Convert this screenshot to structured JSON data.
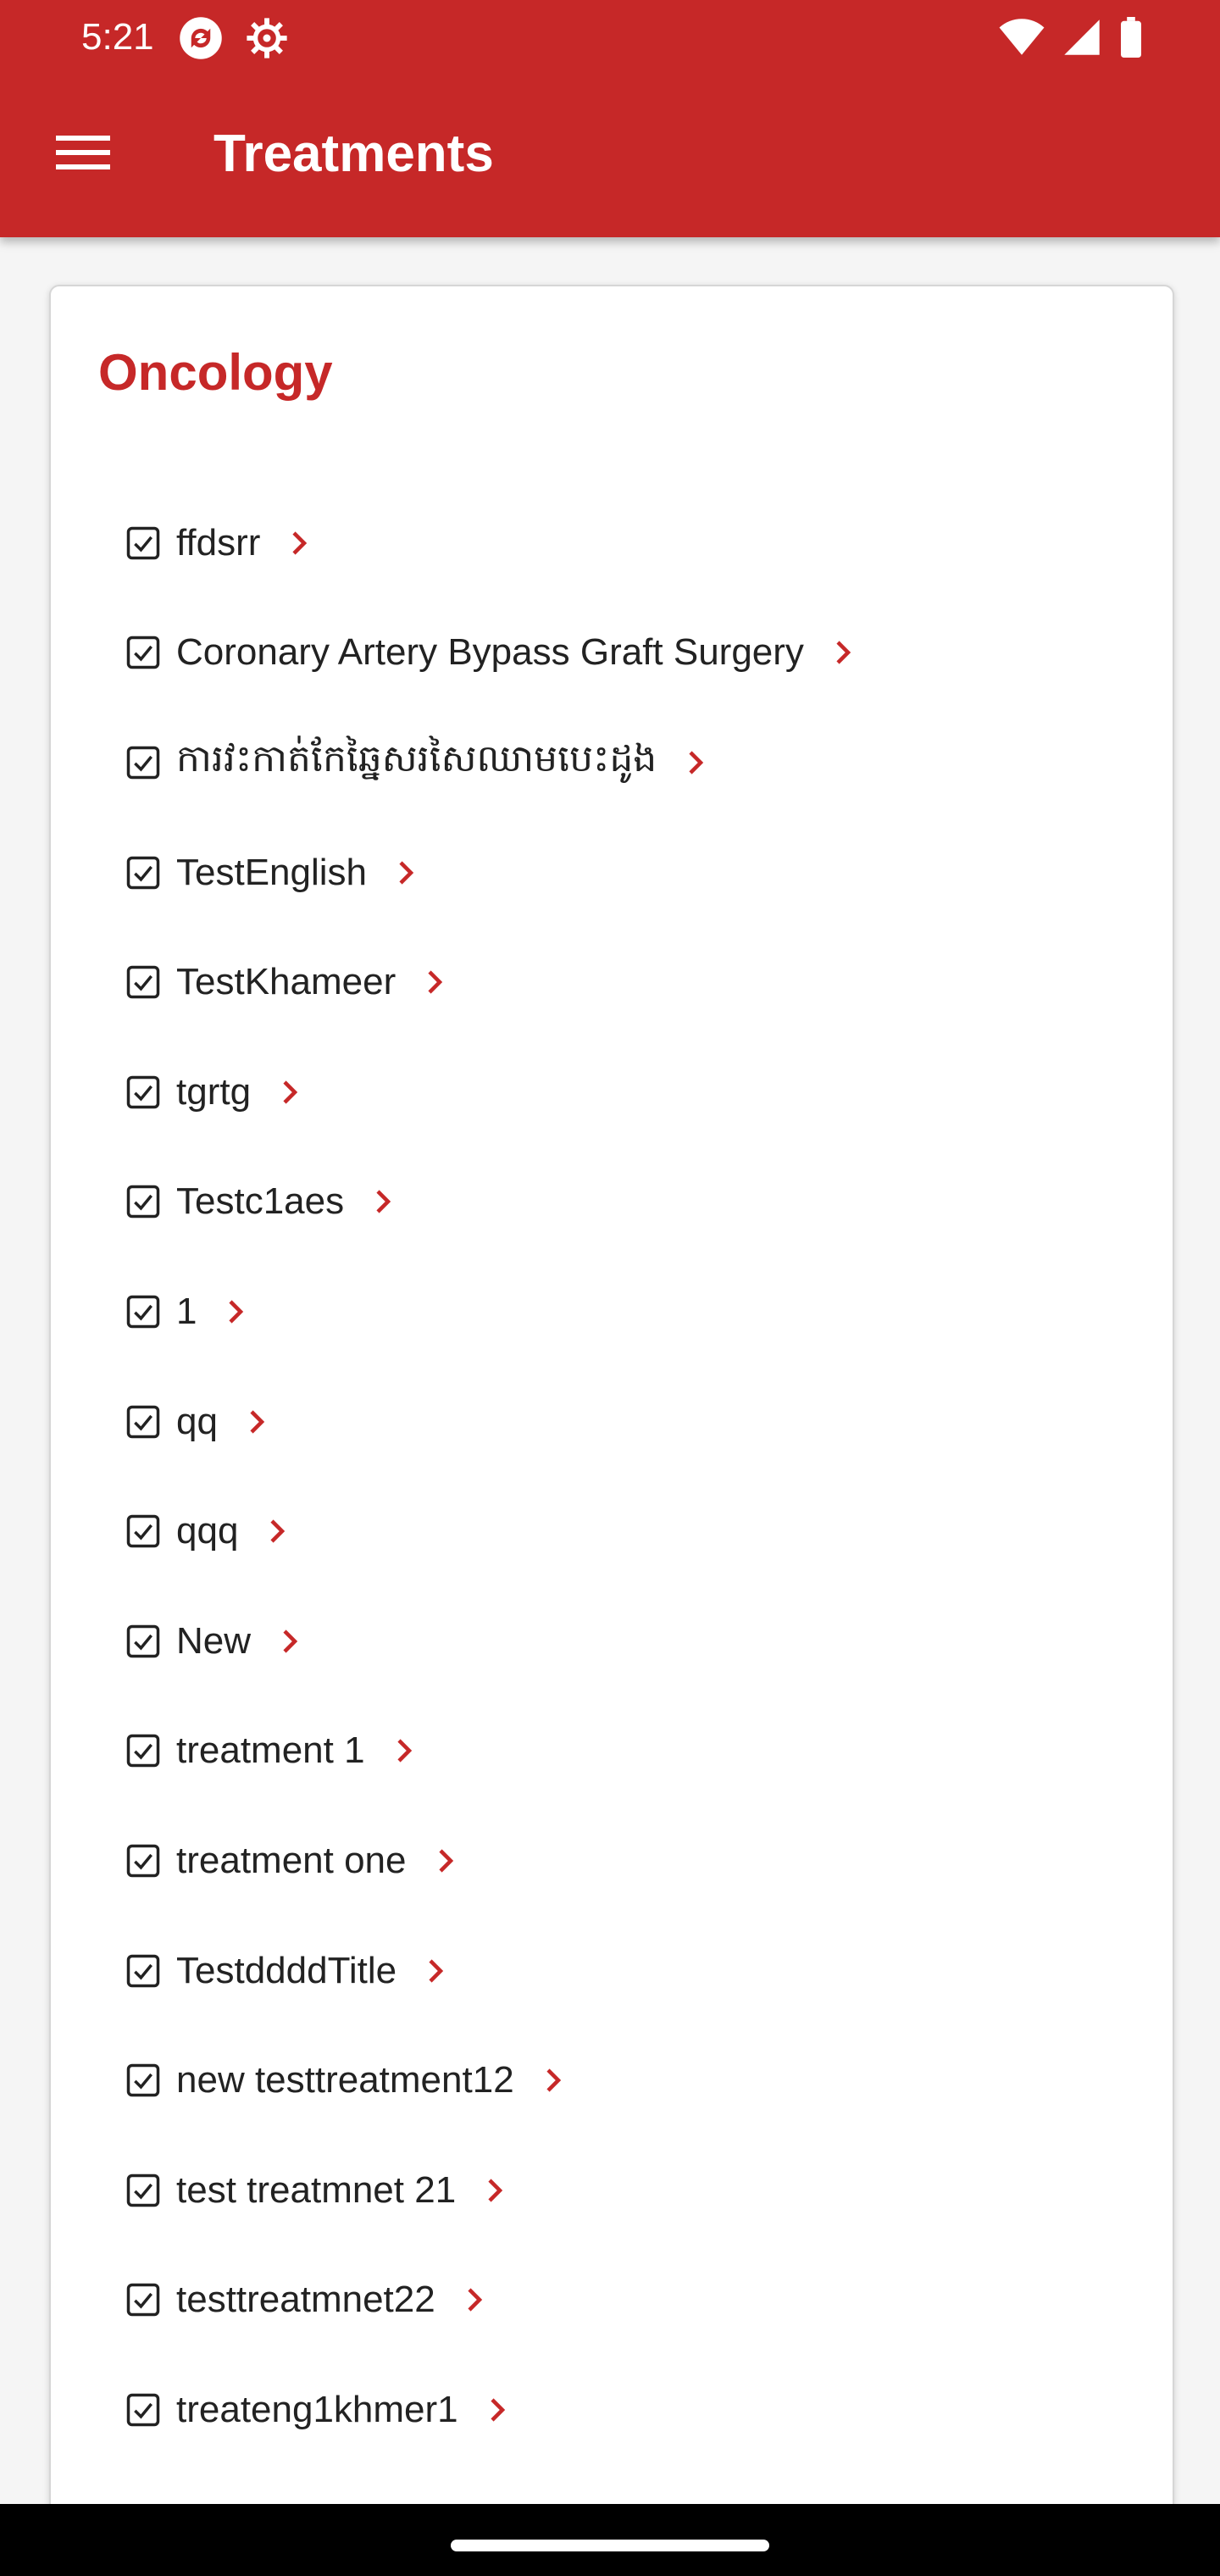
{
  "status_bar": {
    "time": "5:21"
  },
  "app_bar": {
    "title": "Treatments",
    "menu_icon": "hamburger-menu-icon"
  },
  "section": {
    "title": "Oncology"
  },
  "treatments": [
    "ffdsrr",
    "Coronary Artery Bypass Graft Surgery",
    "ការវះកាត់កែឆ្នៃសរសៃឈាមបេះដូង",
    "TestEnglish",
    "TestKhameer",
    "tgrtg",
    "Testc1aes",
    "1",
    "qq",
    "qqq",
    "New",
    "treatment 1",
    "treatment one",
    "TestddddTitle",
    "new testtreatment12",
    "test treatmnet 21",
    "testtreatmnet22",
    "treateng1khmer1"
  ],
  "colors": {
    "primary": "#c62828",
    "text": "#222222"
  },
  "icons": {
    "item_check": "checkbox-checked-icon",
    "item_chevron": "chevron-right-icon"
  }
}
